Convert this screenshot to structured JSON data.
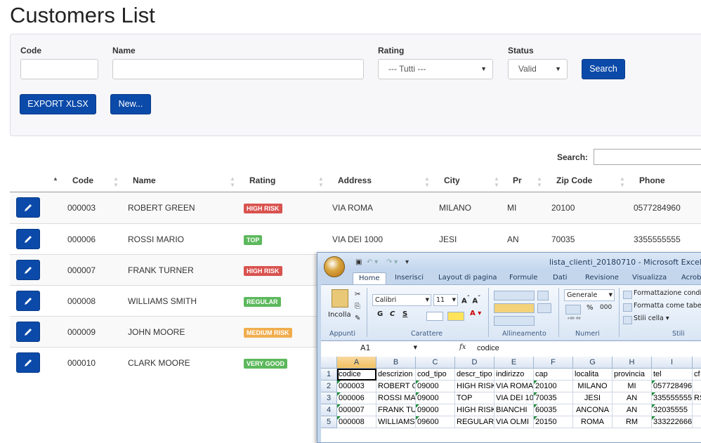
{
  "page": {
    "title": "Customers List"
  },
  "filters": {
    "code_label": "Code",
    "name_label": "Name",
    "rating_label": "Rating",
    "rating_value": "--- Tutti ---",
    "status_label": "Status",
    "status_value": "Valid",
    "search_button": "Search",
    "export_button": "EXPORT XLSX",
    "new_button": "New..."
  },
  "table": {
    "search_label": "Search:",
    "headers": [
      "Code",
      "Name",
      "Rating",
      "Address",
      "City",
      "Pr",
      "Zip Code",
      "Phone"
    ],
    "rows": [
      {
        "code": "000003",
        "name": "ROBERT GREEN",
        "rating": "HIGH RISK",
        "address": "VIA ROMA",
        "city": "MILANO",
        "pr": "MI",
        "zip": "20100",
        "phone": "0577284960"
      },
      {
        "code": "000006",
        "name": "ROSSI MARIO",
        "rating": "TOP",
        "address": "VIA DEI 1000",
        "city": "JESI",
        "pr": "AN",
        "zip": "70035",
        "phone": "3355555555"
      },
      {
        "code": "000007",
        "name": "FRANK TURNER",
        "rating": "HIGH RISK"
      },
      {
        "code": "000008",
        "name": "WILLIAMS SMITH",
        "rating": "REGULAR"
      },
      {
        "code": "000009",
        "name": "JOHN MOORE",
        "rating": "MEDIUM RISK"
      },
      {
        "code": "000010",
        "name": "CLARK MOORE",
        "rating": "VERY GOOD"
      }
    ],
    "badge_colors": {
      "HIGH RISK": "#d9534f",
      "TOP": "#5cb85c",
      "REGULAR": "#5cb85c",
      "MEDIUM RISK": "#f0ad4e",
      "VERY GOOD": "#5cb85c"
    }
  },
  "excel": {
    "title": "lista_clienti_20180710 - Microsoft Excel",
    "tabs": [
      "Home",
      "Inserisci",
      "Layout di pagina",
      "Formule",
      "Dati",
      "Revisione",
      "Visualizza",
      "Acroba"
    ],
    "ribbon": {
      "paste": "Incolla",
      "font_name": "Calibri",
      "font_size": "11",
      "number_format": "Generale",
      "bold": "G",
      "italic": "C",
      "underline": "S",
      "percent": "%",
      "thousands": "000",
      "cond_format": "Formattazione condi",
      "table_format": "Formatta come tabel",
      "cell_styles": "Stili cella",
      "groups": [
        "Appunti",
        "Carattere",
        "Allineamento",
        "Numeri",
        "Stili"
      ]
    },
    "name_box": "A1",
    "fx": "fx",
    "formula": "codice",
    "columns": [
      "A",
      "B",
      "C",
      "D",
      "E",
      "F",
      "G",
      "H",
      "I"
    ],
    "rows": [
      [
        "1",
        "codice",
        "descrizion",
        "cod_tipo",
        "descr_tipo",
        "indirizzo",
        "cap",
        "localita",
        "provincia",
        "tel",
        "cf"
      ],
      [
        "2",
        "000003",
        "ROBERT G",
        "09000",
        "HIGH RISK",
        "VIA ROMA",
        "20100",
        "MILANO",
        "MI",
        "0577284960",
        ""
      ],
      [
        "3",
        "000006",
        "ROSSI MA",
        "09000",
        "TOP",
        "VIA DEI 10",
        "70035",
        "JESI",
        "AN",
        "3355555555",
        "RS"
      ],
      [
        "4",
        "000007",
        "FRANK TU",
        "09000",
        "HIGH RISK",
        "BIANCHI",
        "60035",
        "ANCONA",
        "AN",
        "32035555",
        ""
      ],
      [
        "5",
        "000008",
        "WILLIAMS",
        "09600",
        "REGULAR",
        "VIA OLMI",
        "20150",
        "ROMA",
        "RM",
        "333222666",
        ""
      ]
    ]
  }
}
